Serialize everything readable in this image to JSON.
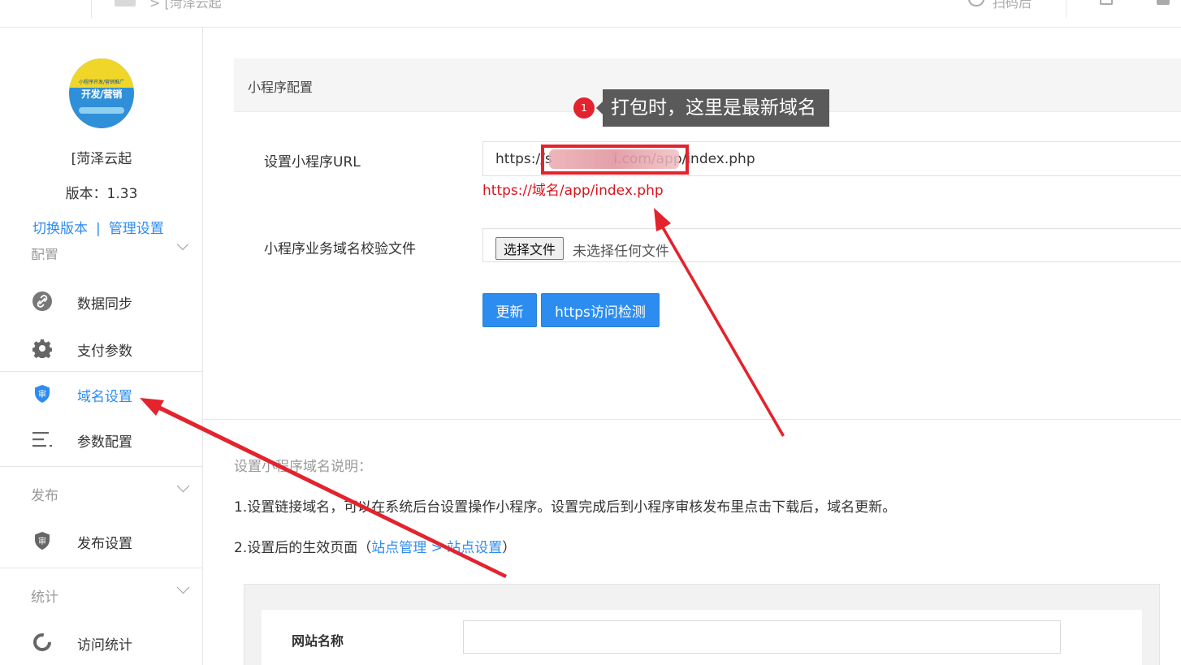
{
  "topbar": {
    "breadcrumb": "[菏泽云起",
    "right_label": "扫码后"
  },
  "sidebar": {
    "site_name": "[菏泽云起",
    "version": "版本：1.33",
    "switch_version": "切换版本",
    "link_sep": "|",
    "manage_settings": "管理设置",
    "section_config": "配置",
    "items_config": [
      {
        "label": "数据同步",
        "icon": "link-icon"
      },
      {
        "label": "支付参数",
        "icon": "gear-icon"
      },
      {
        "label": "域名设置",
        "icon": "shield-icon",
        "active": true
      },
      {
        "label": "参数配置",
        "icon": "list-icon"
      }
    ],
    "group_publish": "发布",
    "items_publish": [
      {
        "label": "发布设置",
        "icon": "shield-icon"
      }
    ],
    "group_stats": "统计",
    "items_stats": [
      {
        "label": "访问统计",
        "icon": "refresh-icon"
      }
    ],
    "logo_text": "开发/营销"
  },
  "panel": {
    "title": "小程序配置",
    "url_label": "设置小程序URL",
    "url_value": "https://s              i.com/app/index.php",
    "url_hint": "https://域名/app/index.php",
    "file_label": "小程序业务域名校验文件",
    "file_button": "选择文件",
    "file_status": "未选择任何文件",
    "update_button": "更新",
    "https_button": "https访问检测"
  },
  "description": {
    "title": "设置小程序域名说明：",
    "line1": "1.设置链接域名，可以在系统后台设置操作小程序。设置完成后到小程序审核发布里点击下载后，域名更新。",
    "line2_prefix": "2.设置后的生效页面（",
    "line2_link1": "站点管理",
    "line2_sep": " > ",
    "line2_link2": "站点设置",
    "line2_suffix": "）"
  },
  "embedded": {
    "site_name_label": "网站名称"
  },
  "annotation": {
    "badge": "1",
    "tip": "打包时，这里是最新域名"
  },
  "colors": {
    "accent": "#2d8cf0",
    "danger": "#d9141c",
    "annotation_red": "#e3232d",
    "tooltip_bg": "#5a5a5a"
  }
}
